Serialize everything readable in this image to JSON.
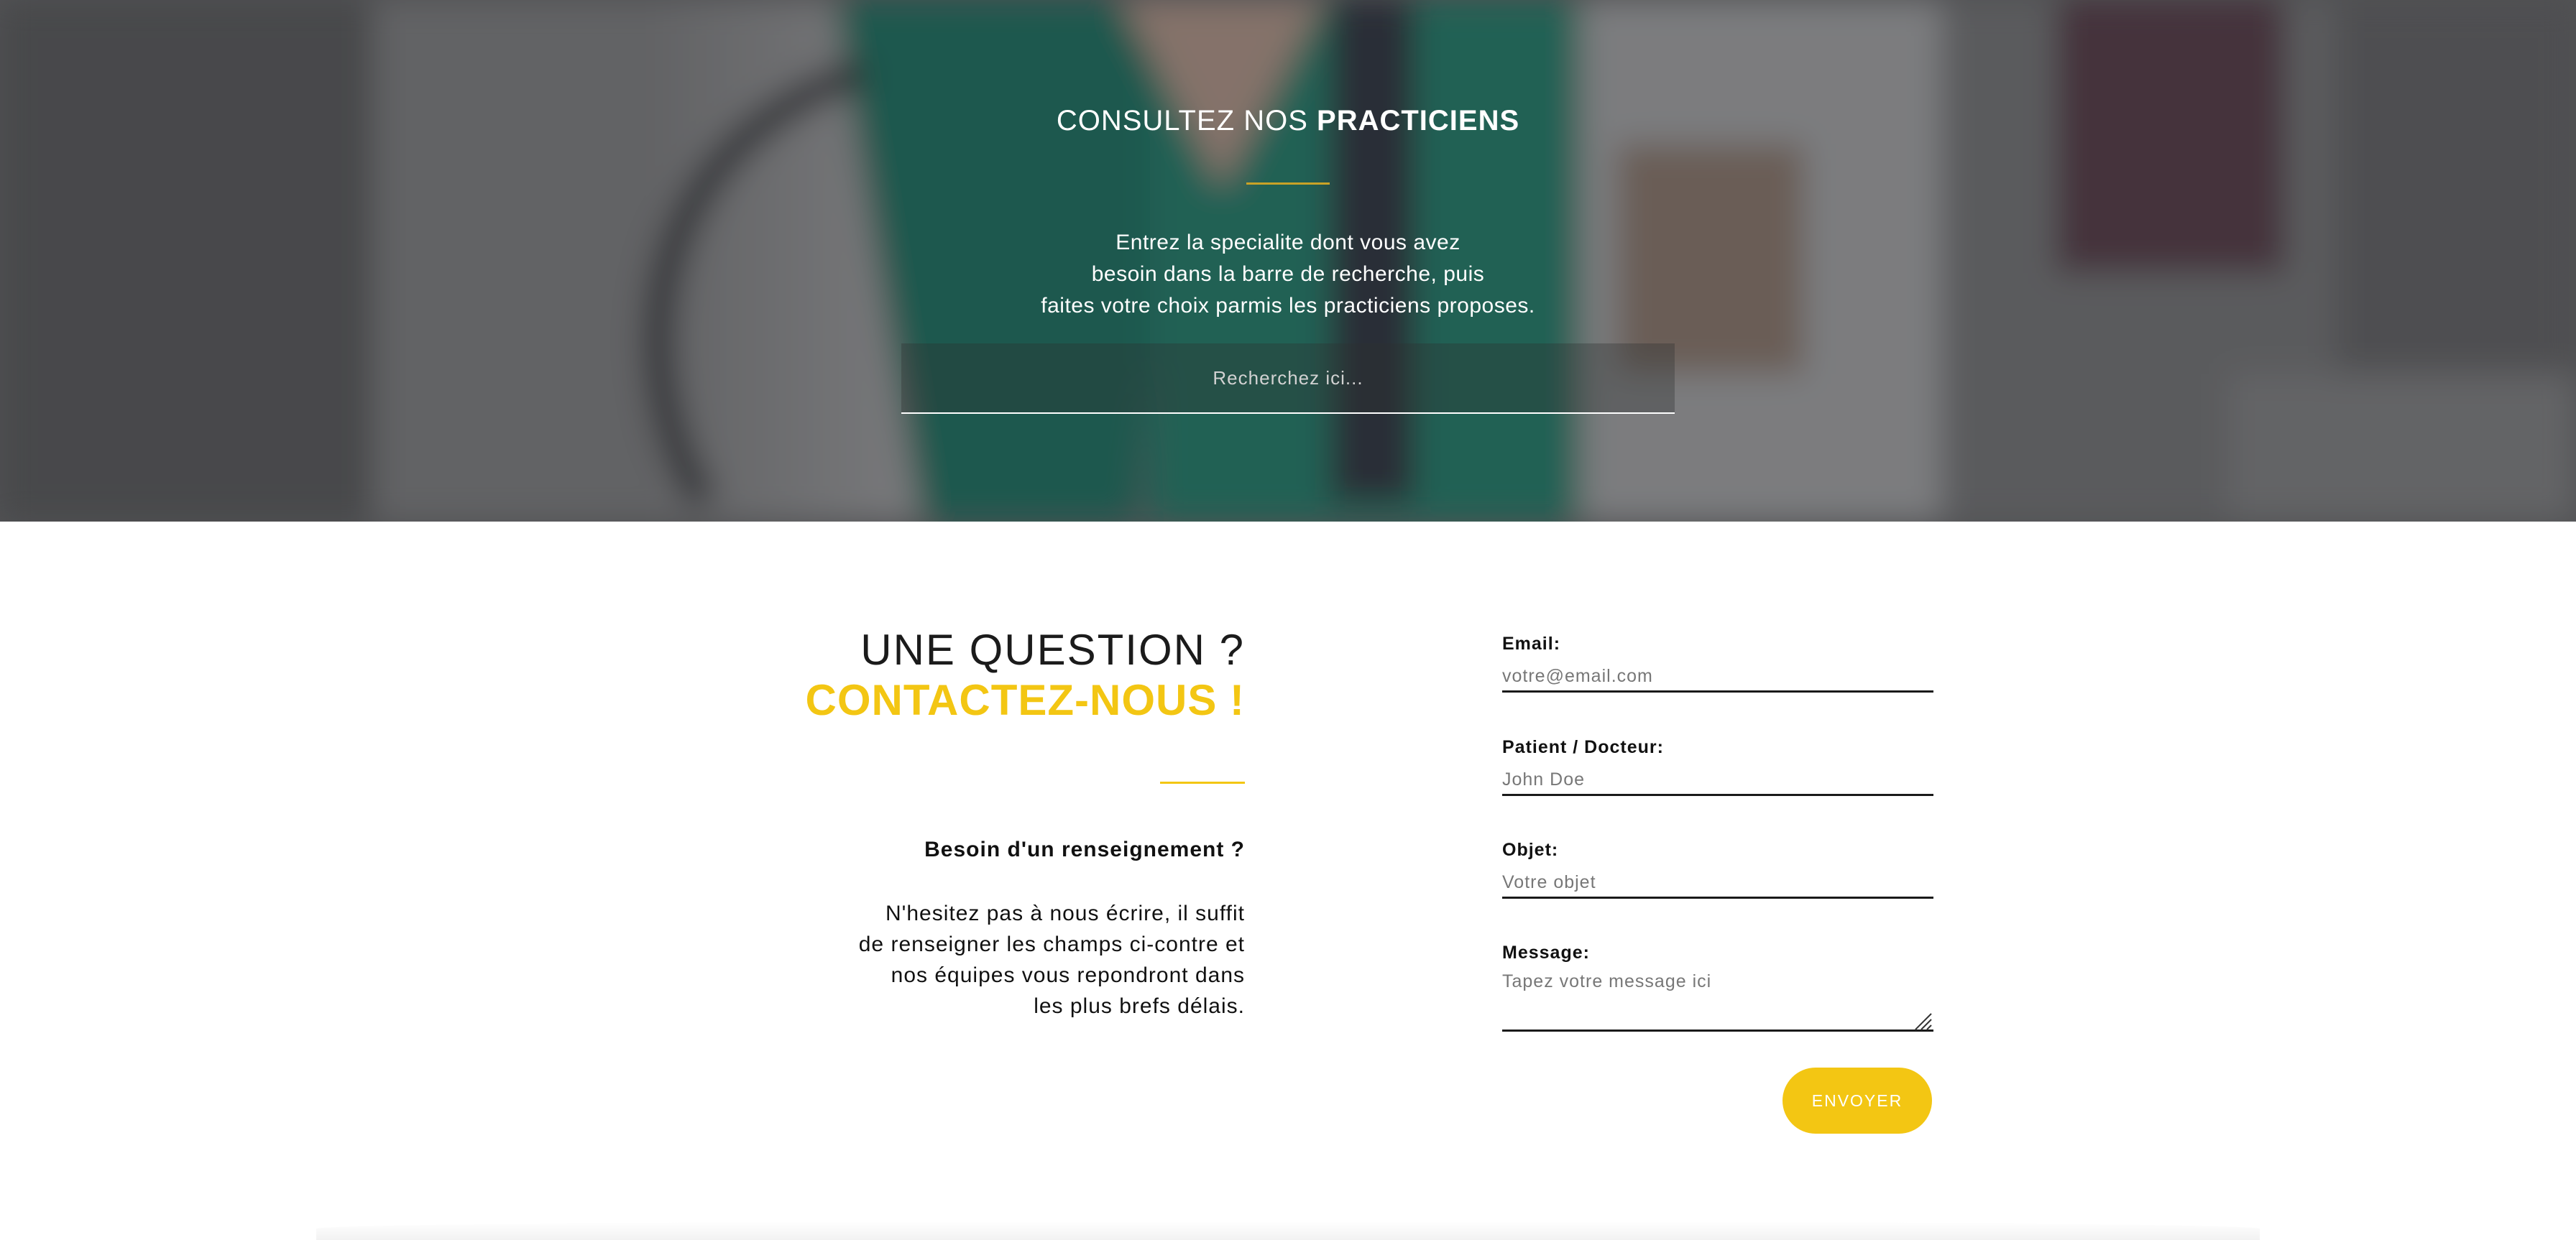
{
  "hero": {
    "title_regular": "CONSULTEZ NOS ",
    "title_bold": "PRACTICIENS",
    "description_lines": [
      "Entrez la specialite dont vous avez",
      "besoin dans la barre de recherche, puis",
      "faites votre choix parmis les practiciens proposes."
    ],
    "search_placeholder": "Recherchez ici..."
  },
  "contact": {
    "title_line1": "UNE QUESTION ?",
    "title_line2": "CONTACTEZ-NOUS !",
    "subtitle": "Besoin d'un renseignement ?",
    "text_lines": [
      "N'hesitez pas à nous écrire, il suffit",
      "de renseigner les champs ci-contre et",
      "nos équipes vous repondront dans",
      "les plus brefs délais."
    ]
  },
  "form": {
    "email_label": "Email:",
    "email_placeholder": "votre@email.com",
    "name_label": "Patient / Docteur:",
    "name_placeholder": "John Doe",
    "subject_label": "Objet:",
    "subject_placeholder": "Votre objet",
    "message_label": "Message:",
    "message_placeholder": "Tapez votre message ici",
    "submit_label": "ENVOYER"
  },
  "colors": {
    "accent": "#f3c613",
    "hero_divider": "#c9a227",
    "text_dark": "#111111"
  },
  "icons": {
    "resize_handle": "resize-grip-icon"
  }
}
